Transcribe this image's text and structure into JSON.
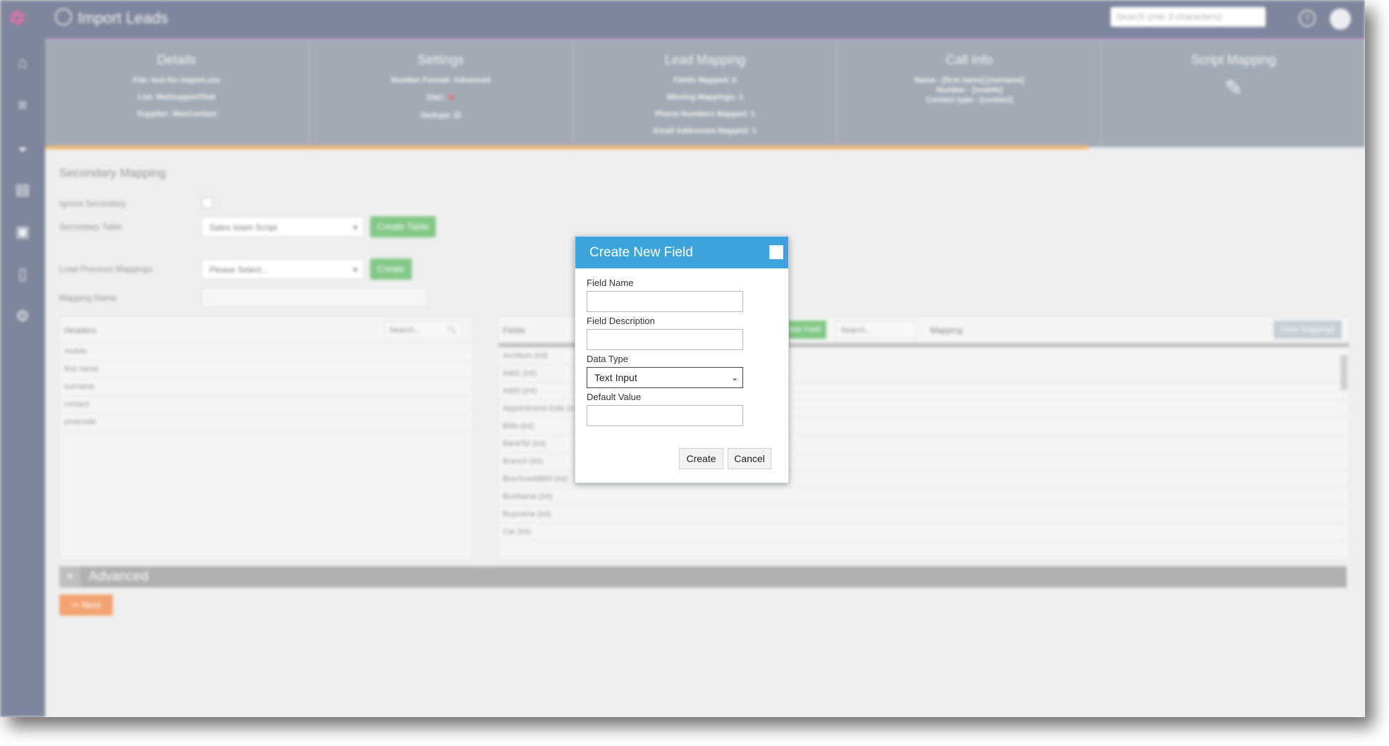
{
  "app": {
    "title": "Import Leads",
    "search_placeholder": "Search (min 3 characters)"
  },
  "steps": [
    {
      "title": "Details",
      "lines": [
        "File: test-for-import.csv",
        "List: MailsupportTest",
        "Supplier: MaxContact"
      ]
    },
    {
      "title": "Settings",
      "lines": [
        "Number Format: Advanced",
        "DNC:",
        "Dedupe:"
      ]
    },
    {
      "title": "Lead Mapping",
      "lines": [
        "Fields Mapped: 0",
        "Missing Mappings: 1",
        "Phone Numbers Mapped: 1",
        "Email Addresses Mapped: 1"
      ]
    },
    {
      "title": "Call Info",
      "lines": [
        "Name - [first name] [surname]",
        "Number - [mobile]",
        "Contact type - [contact]"
      ]
    },
    {
      "title": "Script Mapping",
      "lines": []
    }
  ],
  "secondary": {
    "title": "Secondary Mapping",
    "ignore_label": "Ignore Secondary",
    "table_label": "Secondary Table",
    "table_value": "Sales Islam Script",
    "create_table_label": "Create Table",
    "load_prev_label": "Load Previous Mappings",
    "load_prev_value": "Please Select...",
    "create_label": "Create",
    "mapping_name_label": "Mapping Name"
  },
  "headers_panel": {
    "title": "Headers",
    "search_placeholder": "Search...",
    "rows": [
      "mobile",
      "first name",
      "surname",
      "contact",
      "postcode"
    ]
  },
  "fields_panel": {
    "title": "Fields",
    "new_field_label": "New Field",
    "search_placeholder": "Search...",
    "mapping_title": "Mapping",
    "clear_label": "Clear Mappings",
    "rows": [
      "AccNum (int)",
      "Add1 (int)",
      "Add2 (int)",
      "Appointment Date (int)",
      "BMs (int)",
      "BankTel (int)",
      "Branch (int)",
      "BrochureMBM (int)",
      "BusName (int)",
      "Buyname (int)",
      "Car (int)"
    ]
  },
  "advanced_label": "Advanced",
  "next_label": "Next",
  "modal": {
    "title": "Create New Field",
    "field_name_label": "Field Name",
    "field_description_label": "Field Description",
    "data_type_label": "Data Type",
    "data_type_value": "Text Input",
    "default_value_label": "Default Value",
    "create_label": "Create",
    "cancel_label": "Cancel"
  }
}
